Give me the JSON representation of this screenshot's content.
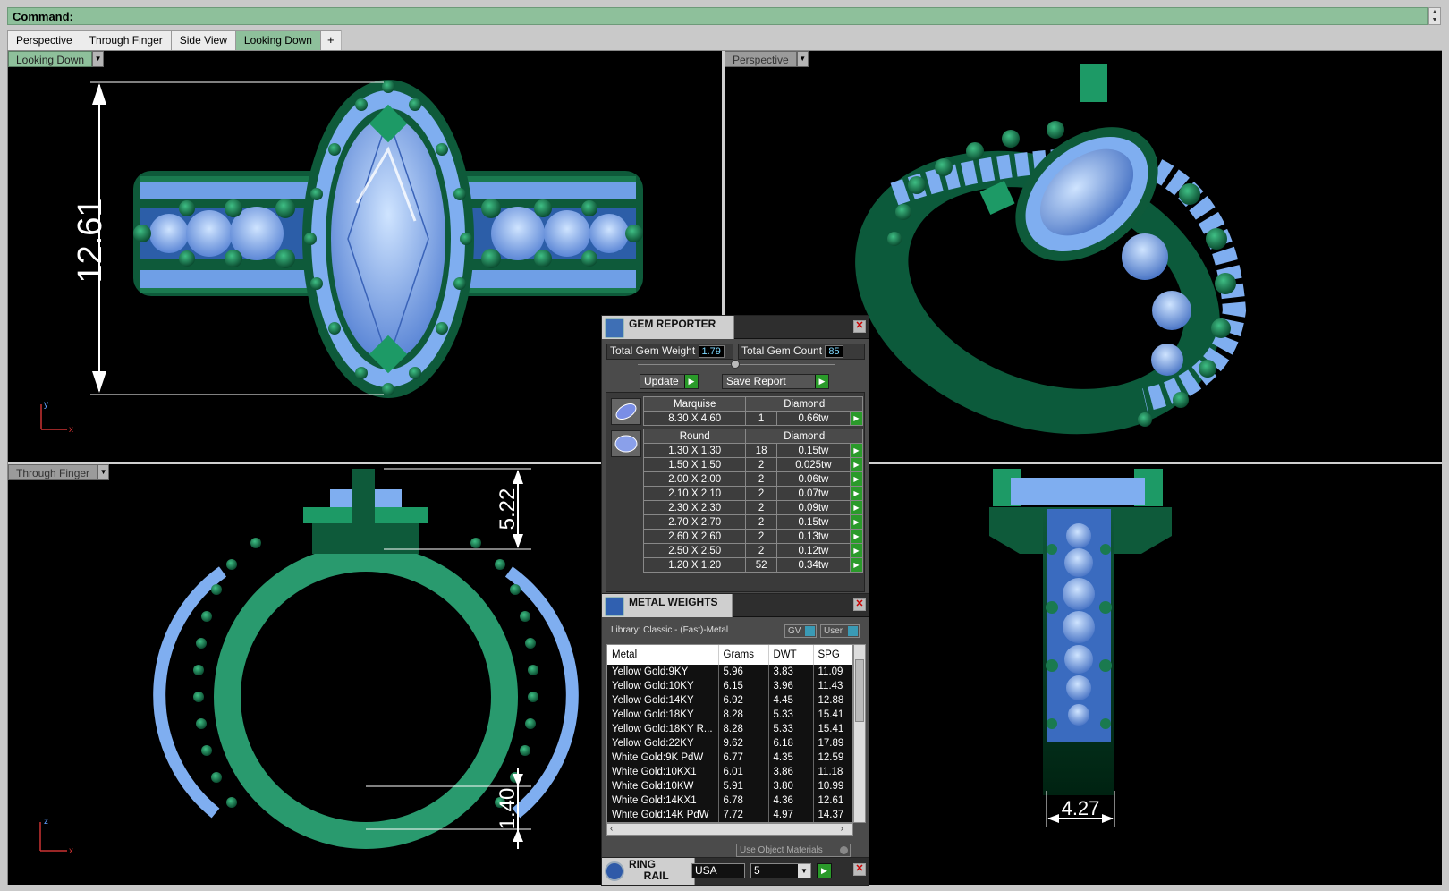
{
  "command": {
    "label": "Command:"
  },
  "tabs": [
    {
      "label": "Perspective",
      "active": false
    },
    {
      "label": "Through Finger",
      "active": false
    },
    {
      "label": "Side View",
      "active": false
    },
    {
      "label": "Looking Down",
      "active": true
    },
    {
      "label": "+",
      "active": false
    }
  ],
  "viewports": {
    "top_left": {
      "label": "Looking Down",
      "dimension": "12.61",
      "axis_x": "x",
      "axis_y": "y"
    },
    "top_right": {
      "label": "Perspective"
    },
    "bottom_left": {
      "label": "Through Finger",
      "dimension_top": "5.22",
      "dimension_bottom": "1.40",
      "axis_x": "x",
      "axis_z": "z"
    },
    "bottom_right": {
      "dimension": "4.27"
    }
  },
  "gem_reporter": {
    "title": "GEM REPORTER",
    "total_weight_label": "Total Gem Weight",
    "total_weight_value": "1.79",
    "total_count_label": "Total Gem Count",
    "total_count_value": "85",
    "update_label": "Update",
    "save_label": "Save Report",
    "groups": [
      {
        "shape": "Marquise",
        "material": "Diamond",
        "rows": [
          {
            "size": "8.30 X 4.60",
            "count": "1",
            "weight": "0.66tw"
          }
        ]
      },
      {
        "shape": "Round",
        "material": "Diamond",
        "rows": [
          {
            "size": "1.30 X 1.30",
            "count": "18",
            "weight": "0.15tw"
          },
          {
            "size": "1.50 X 1.50",
            "count": "2",
            "weight": "0.025tw"
          },
          {
            "size": "2.00 X 2.00",
            "count": "2",
            "weight": "0.06tw"
          },
          {
            "size": "2.10 X 2.10",
            "count": "2",
            "weight": "0.07tw"
          },
          {
            "size": "2.30 X 2.30",
            "count": "2",
            "weight": "0.09tw"
          },
          {
            "size": "2.70 X 2.70",
            "count": "2",
            "weight": "0.15tw"
          },
          {
            "size": "2.60 X 2.60",
            "count": "2",
            "weight": "0.13tw"
          },
          {
            "size": "2.50 X 2.50",
            "count": "2",
            "weight": "0.12tw"
          },
          {
            "size": "1.20 X 1.20",
            "count": "52",
            "weight": "0.34tw"
          }
        ]
      }
    ]
  },
  "metal_weights": {
    "title": "METAL WEIGHTS",
    "library": "Library: Classic - (Fast)-Metal",
    "gv_label": "GV",
    "user_label": "User",
    "columns": [
      "Metal",
      "Grams",
      "DWT",
      "SPG"
    ],
    "rows": [
      [
        "Yellow Gold:9KY",
        "5.96",
        "3.83",
        "11.09"
      ],
      [
        "Yellow Gold:10KY",
        "6.15",
        "3.96",
        "11.43"
      ],
      [
        "Yellow Gold:14KY",
        "6.92",
        "4.45",
        "12.88"
      ],
      [
        "Yellow Gold:18KY",
        "8.28",
        "5.33",
        "15.41"
      ],
      [
        "Yellow Gold:18KY R...",
        "8.28",
        "5.33",
        "15.41"
      ],
      [
        "Yellow Gold:22KY",
        "9.62",
        "6.18",
        "17.89"
      ],
      [
        "White Gold:9K PdW",
        "6.77",
        "4.35",
        "12.59"
      ],
      [
        "White Gold:10KX1",
        "6.01",
        "3.86",
        "11.18"
      ],
      [
        "White Gold:10KW",
        "5.91",
        "3.80",
        "10.99"
      ],
      [
        "White Gold:14KX1",
        "6.78",
        "4.36",
        "12.61"
      ],
      [
        "White Gold:14K PdW",
        "7.72",
        "4.97",
        "14.37"
      ]
    ],
    "use_object_materials": "Use Object Materials"
  },
  "ring_rail": {
    "title_line1": "RING",
    "title_line2": "RAIL",
    "country": "USA",
    "size": "5"
  }
}
